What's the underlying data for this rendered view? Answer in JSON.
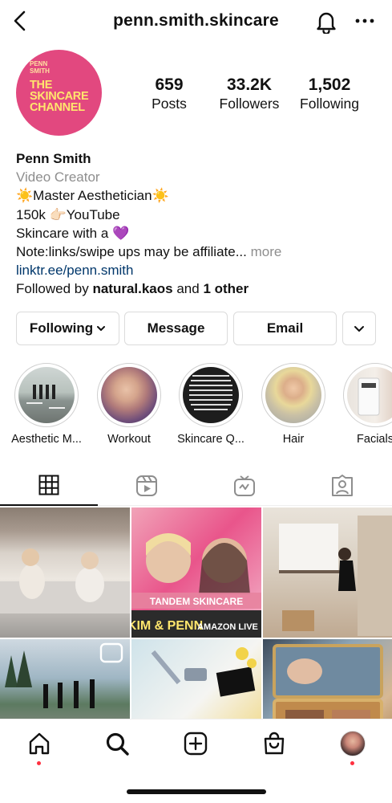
{
  "header": {
    "username": "penn.smith.skincare"
  },
  "profile": {
    "avatar_text_line1": "PENN",
    "avatar_text_line2": "SMITH",
    "avatar_text_channel": "THE SKINCARE CHANNEL",
    "stats": {
      "posts_count": "659",
      "posts_label": "Posts",
      "followers_count": "33.2K",
      "followers_label": "Followers",
      "following_count": "1,502",
      "following_label": "Following"
    },
    "name": "Penn Smith",
    "category": "Video Creator",
    "bio_line1": "☀️Master Aesthetician☀️",
    "bio_line2": "150k 👉🏻YouTube",
    "bio_line3": "Skincare with a 💜",
    "bio_line4": "Note:links/swipe ups may be affiliate...",
    "bio_more": "more",
    "link": "linktr.ee/penn.smith",
    "followed_by_prefix": "Followed by",
    "followed_by_user": "natural.kaos",
    "followed_by_and": "and",
    "followed_by_other": "1 other"
  },
  "actions": {
    "following_label": "Following",
    "message_label": "Message",
    "email_label": "Email"
  },
  "highlights": [
    {
      "label": "Aesthetic M..."
    },
    {
      "label": "Workout"
    },
    {
      "label": "Skincare Q..."
    },
    {
      "label": "Hair"
    },
    {
      "label": "Facials"
    }
  ],
  "grid_overlays": {
    "tandem": "TANDEM SKINCARE",
    "kim_penn": "KIM & PENN",
    "amazon_live": "AMAZON LIVE"
  },
  "colors": {
    "avatar_bg": "#e2487f",
    "avatar_text": "#ffe66d",
    "link": "#00376b",
    "muted": "#8e8e8e",
    "notification_dot": "#ff3040"
  }
}
